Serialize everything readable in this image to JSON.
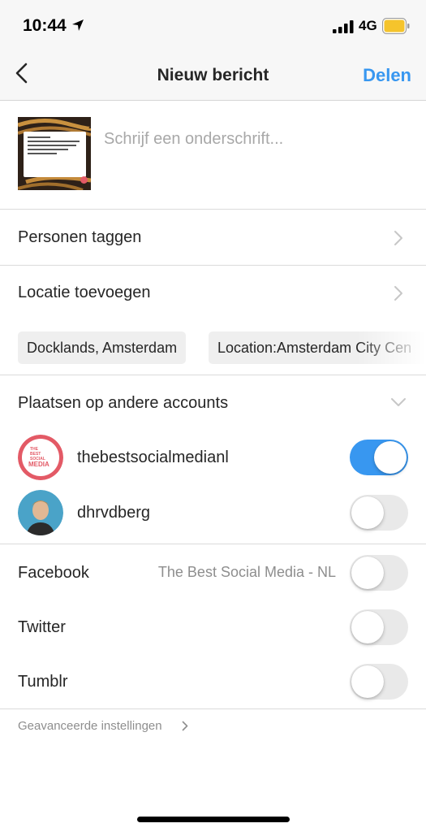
{
  "status_bar": {
    "time": "10:44",
    "network": "4G"
  },
  "nav": {
    "title": "Nieuw bericht",
    "share_label": "Delen"
  },
  "compose": {
    "caption_placeholder": "Schrijf een onderschrift..."
  },
  "rows": {
    "tag_people": "Personen taggen",
    "add_location": "Locatie toevoegen"
  },
  "location_suggestions": [
    "Docklands, Amsterdam",
    "Location:Amsterdam City Cen"
  ],
  "post_to_other_accounts": {
    "title": "Plaatsen op andere accounts",
    "accounts": [
      {
        "name": "thebestsocialmedianl",
        "enabled": true,
        "avatar_text": [
          "THE",
          "BEST",
          "SOCIAL",
          "MEDIA"
        ]
      },
      {
        "name": "dhrvdberg",
        "enabled": false
      }
    ]
  },
  "share_to": {
    "facebook": {
      "label": "Facebook",
      "account": "The Best Social Media - NL",
      "enabled": false
    },
    "twitter": {
      "label": "Twitter",
      "enabled": false
    },
    "tumblr": {
      "label": "Tumblr",
      "enabled": false
    }
  },
  "advanced_settings": "Geavanceerde instellingen",
  "colors": {
    "accent": "#3897f0",
    "brand_pink": "#e35a66"
  }
}
